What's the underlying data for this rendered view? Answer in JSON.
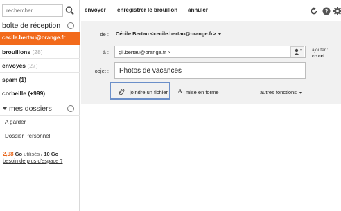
{
  "search": {
    "placeholder": "rechercher ..."
  },
  "sidebar": {
    "inbox_label": "boîte de réception",
    "account": "cecile.bertau@orange.fr",
    "folders": [
      {
        "label": "brouillons",
        "count": "(28)"
      },
      {
        "label": "envoyés",
        "count": "(27)"
      },
      {
        "label": "spam (1)",
        "count": ""
      },
      {
        "label": "corbeille (+999)",
        "count": ""
      }
    ],
    "my_folders_label": "mes dossiers",
    "sub_folders": [
      "A garder",
      "Dossier Personnel"
    ],
    "storage": {
      "used": "2,98",
      "used_unit": " Go",
      "used_text": " utilisés / ",
      "total": "10 Go",
      "link": "besoin de plus d'espace ?"
    }
  },
  "toolbar": {
    "send": "envoyer",
    "save_draft": "enregistrer le brouillon",
    "cancel": "annuler"
  },
  "compose": {
    "from_label": "de :",
    "from_value": "Cécile Bertau <cecile.bertau@orange.fr>",
    "to_label": "à :",
    "to_recipient": "gil.bertau@orange.fr",
    "to_remove": "×",
    "add_label": "ajouter :",
    "add_cc": "cc  cci",
    "subject_label": "objet :",
    "subject_value": "Photos de vacances",
    "attach_label": "joindre un fichier",
    "format_label": "mise en forme",
    "more_label": "autres fonctions"
  },
  "colors": {
    "accent": "#f26a1b",
    "focus_border": "#6b8fc9",
    "compose_bg": "#f1f1f1"
  },
  "icons": [
    "search-icon",
    "plus-circle-icon",
    "refresh-icon",
    "help-icon",
    "gear-icon",
    "contacts-icon",
    "paperclip-icon",
    "text-format-icon",
    "chevron-down-icon"
  ]
}
